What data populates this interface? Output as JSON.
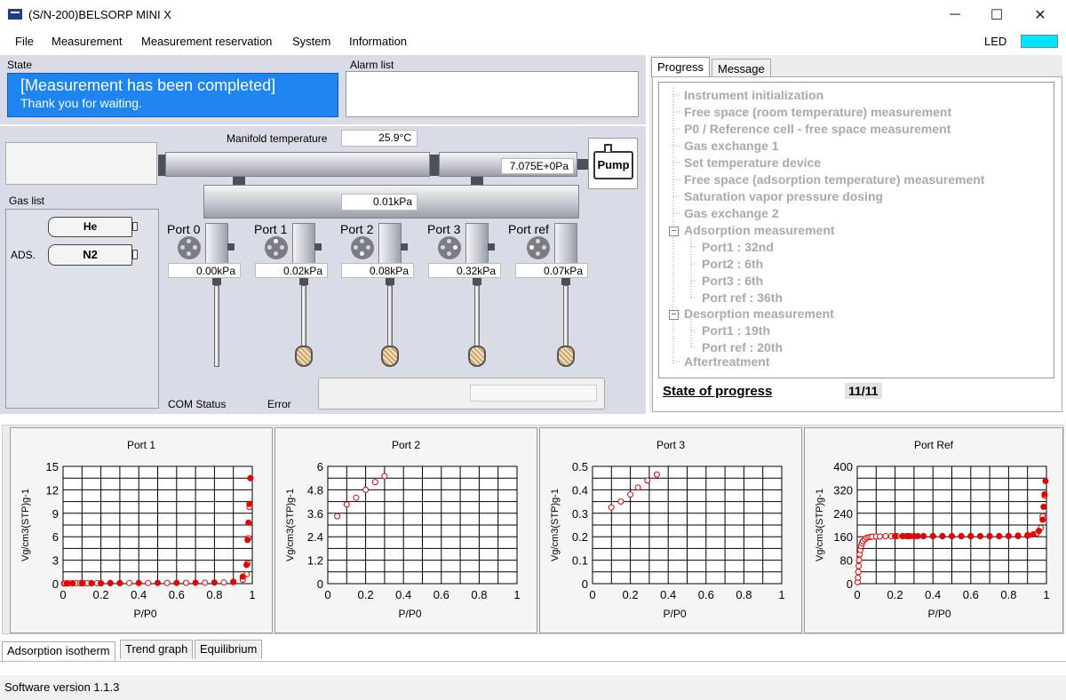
{
  "window": {
    "title": "(S/N-200)BELSORP MINI X",
    "minimize": "─",
    "maximize": "☐",
    "close": "✕"
  },
  "menu": [
    "File",
    "Measurement",
    "Measurement reservation",
    "System",
    "Information"
  ],
  "led": {
    "label": "LED",
    "color": "#00e5ff"
  },
  "state": {
    "label": "State",
    "line1": "[Measurement has been completed]",
    "line2": "Thank you for waiting."
  },
  "alarm": {
    "label": "Alarm list"
  },
  "manifold": {
    "temp_label": "Manifold temperature",
    "temp_value": "25.9°C",
    "pressure_right": "7.075E+0Pa",
    "pressure_manifold": "0.01kPa",
    "pump_label": "Pump"
  },
  "gas": {
    "label": "Gas list",
    "he": "He",
    "ads_label": "ADS.",
    "n2": "N2"
  },
  "ports": [
    {
      "name": "Port 0",
      "value": "0.00kPa"
    },
    {
      "name": "Port 1",
      "value": "0.02kPa"
    },
    {
      "name": "Port 2",
      "value": "0.08kPa"
    },
    {
      "name": "Port 3",
      "value": "0.32kPa"
    },
    {
      "name": "Port ref",
      "value": "0.07kPa"
    }
  ],
  "footer_labels": {
    "com": "COM Status",
    "error": "Error"
  },
  "right": {
    "tabs": [
      "Progress",
      "Message"
    ],
    "tree": [
      "Instrument initialization",
      "Free space (room temperature) measurement",
      "P0 / Reference cell - free space measurement",
      "Gas exchange 1",
      "Set temperature device",
      "Free space (adsorption temperature) measurement",
      "Saturation vapor pressure dosing",
      "Gas exchange 2",
      "Adsorption measurement",
      "Port1 : 32nd",
      "Port2 : 6th",
      "Port3 : 6th",
      "Port ref : 36th",
      "Desorption measurement",
      "Port1 : 19th",
      "Port ref : 20th",
      "Aftertreatment"
    ],
    "collapse_glyph": "−",
    "state_label": "State of progress",
    "state_value": "11/11"
  },
  "chart_data": [
    {
      "type": "scatter",
      "title": "Port 1",
      "xlabel": "P/P0",
      "ylabel": "Vg/cm3(STP)g-1",
      "xlim": [
        0,
        1
      ],
      "ylim": [
        0,
        15
      ],
      "xticks": [
        "0",
        "0.2",
        "0.4",
        "0.6",
        "0.8",
        "1"
      ],
      "yticks": [
        "0",
        "3",
        "6",
        "9",
        "12",
        "15"
      ],
      "series": [
        {
          "kind": "adsorption",
          "x": [
            0.005,
            0.01,
            0.02,
            0.03,
            0.05,
            0.07,
            0.09,
            0.11,
            0.13,
            0.15,
            0.18,
            0.2,
            0.25,
            0.3,
            0.35,
            0.45,
            0.55,
            0.65,
            0.75,
            0.85,
            0.9,
            0.95,
            0.97,
            0.975,
            0.98,
            0.985,
            0.99
          ],
          "y": [
            0.02,
            0.03,
            0.03,
            0.04,
            0.04,
            0.05,
            0.05,
            0.05,
            0.05,
            0.06,
            0.06,
            0.06,
            0.07,
            0.07,
            0.08,
            0.08,
            0.09,
            0.1,
            0.12,
            0.15,
            0.2,
            0.5,
            1.2,
            2.6,
            5.8,
            9.8,
            13.5
          ]
        },
        {
          "kind": "desorption",
          "x": [
            0.99,
            0.985,
            0.98,
            0.975,
            0.97,
            0.95,
            0.9,
            0.8,
            0.7,
            0.6,
            0.5,
            0.4,
            0.3,
            0.25,
            0.2,
            0.15,
            0.1,
            0.05,
            0.02
          ],
          "y": [
            13.5,
            10.2,
            7.8,
            5.6,
            2.4,
            0.9,
            0.25,
            0.14,
            0.12,
            0.1,
            0.09,
            0.08,
            0.07,
            0.07,
            0.06,
            0.06,
            0.05,
            0.04,
            0.03
          ]
        }
      ]
    },
    {
      "type": "scatter",
      "title": "Port 2",
      "xlabel": "P/P0",
      "ylabel": "Vg/cm3(STP)g-1",
      "xlim": [
        0,
        1
      ],
      "ylim": [
        0,
        6
      ],
      "xticks": [
        "0",
        "0.2",
        "0.4",
        "0.6",
        "0.8",
        "1"
      ],
      "yticks": [
        "0",
        "1.2",
        "2.4",
        "3.6",
        "4.8",
        "6"
      ],
      "series": [
        {
          "kind": "adsorption",
          "x": [
            0.05,
            0.1,
            0.15,
            0.2,
            0.25,
            0.3
          ],
          "y": [
            3.45,
            4.05,
            4.4,
            4.8,
            5.2,
            5.5
          ]
        }
      ]
    },
    {
      "type": "scatter",
      "title": "Port 3",
      "xlabel": "P/P0",
      "ylabel": "Vg/cm3(STP)g-1",
      "xlim": [
        0,
        1
      ],
      "ylim": [
        0,
        0.5
      ],
      "xticks": [
        "0",
        "0.2",
        "0.4",
        "0.6",
        "0.8",
        "1"
      ],
      "yticks": [
        "0",
        "0.1",
        "0.2",
        "0.3",
        "0.4",
        "0.5"
      ],
      "series": [
        {
          "kind": "adsorption",
          "x": [
            0.1,
            0.15,
            0.2,
            0.24,
            0.29,
            0.34
          ],
          "y": [
            0.325,
            0.35,
            0.38,
            0.41,
            0.44,
            0.465
          ]
        }
      ]
    },
    {
      "type": "scatter",
      "title": "Port Ref",
      "xlabel": "P/P0",
      "ylabel": "Vg/cm3(STP)g-1",
      "xlim": [
        0,
        1
      ],
      "ylim": [
        0,
        400
      ],
      "xticks": [
        "0",
        "0.2",
        "0.4",
        "0.6",
        "0.8",
        "1"
      ],
      "yticks": [
        "0",
        "80",
        "160",
        "240",
        "320",
        "400"
      ],
      "series": [
        {
          "kind": "adsorption",
          "x": [
            0.002,
            0.004,
            0.006,
            0.008,
            0.01,
            0.013,
            0.016,
            0.02,
            0.025,
            0.03,
            0.04,
            0.05,
            0.06,
            0.07,
            0.08,
            0.1,
            0.12,
            0.15,
            0.18,
            0.21,
            0.24,
            0.27,
            0.3,
            0.35,
            0.4,
            0.45,
            0.5,
            0.55,
            0.6,
            0.65,
            0.7,
            0.75,
            0.8,
            0.85,
            0.9,
            0.95,
            0.97,
            0.98,
            0.99
          ],
          "y": [
            5,
            20,
            40,
            60,
            80,
            100,
            115,
            128,
            138,
            145,
            152,
            156,
            158,
            159,
            160,
            161,
            161,
            162,
            162,
            162,
            162,
            162,
            162,
            162,
            162,
            162,
            162,
            162,
            162,
            162,
            162,
            162,
            163,
            164,
            166,
            172,
            190,
            230,
            300
          ]
        },
        {
          "kind": "desorption",
          "x": [
            0.995,
            0.99,
            0.985,
            0.98,
            0.96,
            0.93,
            0.9,
            0.85,
            0.8,
            0.75,
            0.7,
            0.65,
            0.6,
            0.55,
            0.5,
            0.45,
            0.4,
            0.35,
            0.32,
            0.3,
            0.28,
            0.26,
            0.24,
            0.2
          ],
          "y": [
            350,
            305,
            262,
            218,
            180,
            168,
            163,
            162,
            162,
            162,
            162,
            162,
            162,
            162,
            162,
            162,
            162,
            162,
            162,
            162,
            162,
            162,
            162,
            162
          ]
        }
      ]
    }
  ],
  "bottom_tabs": [
    "Adsorption isotherm",
    "Trend graph",
    "Equilibrium"
  ],
  "status": {
    "version": "Software version 1.1.3"
  }
}
